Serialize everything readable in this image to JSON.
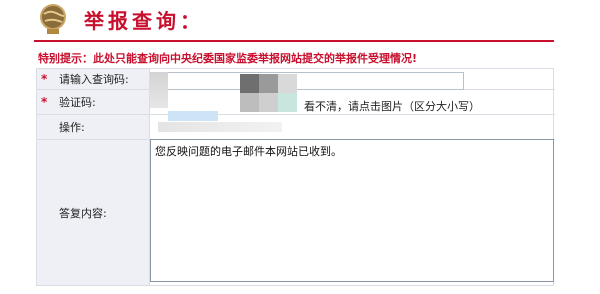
{
  "header": {
    "title": "举报查询：",
    "icon": "globe-icon"
  },
  "notice": "特别提示：此处只能查询向中央纪委国家监委举报网站提交的举报件受理情况!",
  "form": {
    "query_label": "请输入查询码:",
    "captcha_label": "验证码:",
    "captcha_hint": "看不清，请点击图片（区分大小写）",
    "operation_label": "操作:",
    "reply_label": "答复内容:",
    "reply_text": "您反映问题的电子邮件本网站已收到。",
    "required_mark": "*"
  },
  "colors": {
    "accent": "#c8102e",
    "label_bg": "#eef0f6",
    "border": "#d8dde6"
  }
}
